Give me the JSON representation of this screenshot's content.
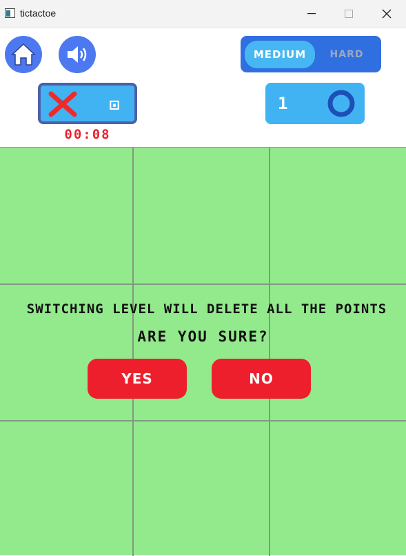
{
  "window": {
    "title": "tictactoe"
  },
  "header": {
    "level": {
      "medium_label": "MEDIUM",
      "hard_label": "HARD",
      "selected": "MEDIUM"
    },
    "player_x": {
      "score": "⊡"
    },
    "timer": "00:08",
    "player_o": {
      "score": "1"
    }
  },
  "dialog": {
    "message": "SWITCHING LEVEL WILL DELETE ALL THE POINTS",
    "question": "ARE YOU SURE?",
    "yes_label": "YES",
    "no_label": "NO"
  },
  "colors": {
    "board": "#93ea8c",
    "card": "#42b3f2",
    "accent_red": "#ee1f2c",
    "toggle": "#2f6fe0"
  }
}
